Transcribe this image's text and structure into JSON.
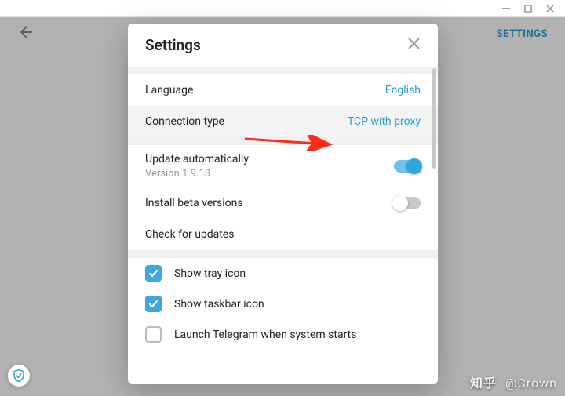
{
  "window": {
    "minimize": "–",
    "maximize": "□",
    "close": "×"
  },
  "header": {
    "settings_link": "SETTINGS"
  },
  "modal": {
    "title": "Settings",
    "rows": {
      "language": {
        "label": "Language",
        "value": "English"
      },
      "connection": {
        "label": "Connection type",
        "value": "TCP with proxy"
      },
      "update_auto": {
        "label": "Update automatically",
        "sub": "Version 1.9.13"
      },
      "install_beta": {
        "label": "Install beta versions"
      },
      "check_updates": {
        "label": "Check for updates"
      }
    },
    "checks": {
      "tray": {
        "label": "Show tray icon",
        "checked": true
      },
      "taskbar": {
        "label": "Show taskbar icon",
        "checked": true
      },
      "autostart": {
        "label": "Launch Telegram when system starts",
        "checked": false
      }
    }
  },
  "watermark": {
    "zh": "知乎",
    "handle": "@Crown"
  },
  "colors": {
    "accent": "#2e9fd8",
    "annotation": "#ff2a1a"
  }
}
